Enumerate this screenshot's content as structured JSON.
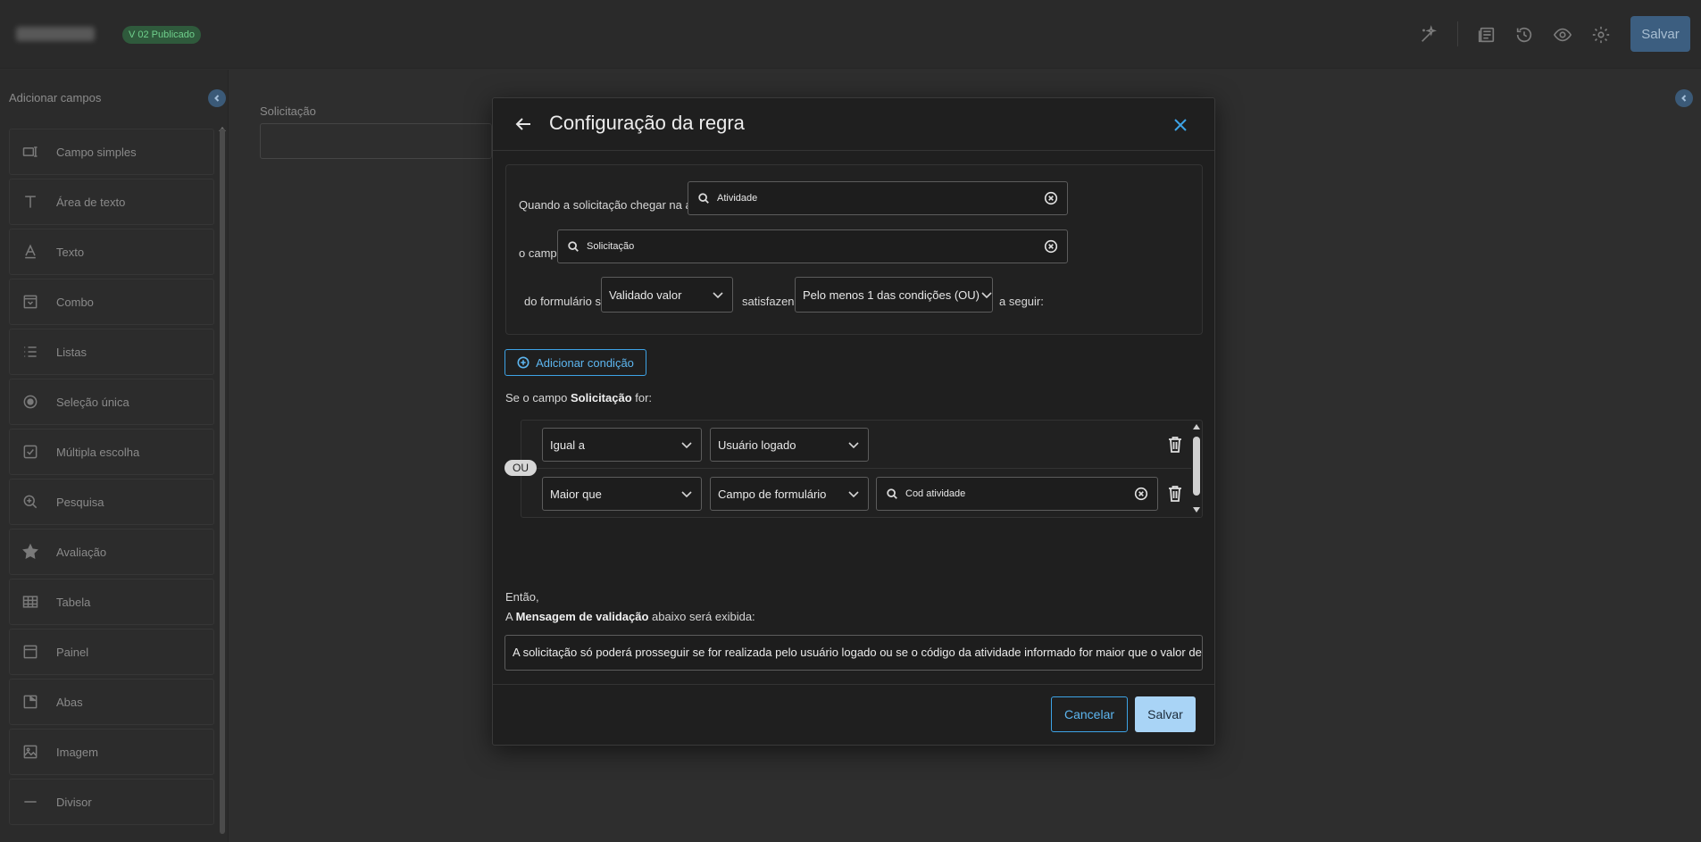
{
  "header": {
    "version_badge": "V 02 Publicado",
    "save_label": "Salvar",
    "icons": [
      "magic-wand-icon",
      "document-list-icon",
      "history-icon",
      "eye-icon",
      "gear-icon"
    ]
  },
  "sidebar": {
    "title": "Adicionar campos",
    "items": [
      {
        "label": "Campo simples",
        "icon": "input-field-icon"
      },
      {
        "label": "Área de texto",
        "icon": "text-area-icon"
      },
      {
        "label": "Texto",
        "icon": "text-icon"
      },
      {
        "label": "Combo",
        "icon": "combo-icon"
      },
      {
        "label": "Listas",
        "icon": "list-icon"
      },
      {
        "label": "Seleção única",
        "icon": "radio-icon"
      },
      {
        "label": "Múltipla escolha",
        "icon": "checkbox-icon"
      },
      {
        "label": "Pesquisa",
        "icon": "search-plus-icon"
      },
      {
        "label": "Avaliação",
        "icon": "star-icon"
      },
      {
        "label": "Tabela",
        "icon": "table-icon"
      },
      {
        "label": "Painel",
        "icon": "panel-icon"
      },
      {
        "label": "Abas",
        "icon": "tabs-icon"
      },
      {
        "label": "Imagem",
        "icon": "image-icon"
      },
      {
        "label": "Divisor",
        "icon": "divider-icon"
      }
    ]
  },
  "canvas": {
    "field_label": "Solicitação"
  },
  "modal": {
    "title": "Configuração da regra",
    "rule": {
      "activity_label": "Quando a solicitação chegar na atividade",
      "activity_value": "Atividade",
      "field_label": "o campo",
      "field_value": "Solicitação",
      "form_label": "do formulário será",
      "action_value": "Validado valor",
      "satisfying_label": "satisfazendo",
      "match_value": "Pelo menos 1 das condições (OU)",
      "suffix_label": "a seguir:"
    },
    "add_condition_label": "Adicionar condição",
    "conditions_caption": {
      "prefix": "Se o campo ",
      "field": "Solicitação",
      "suffix": " for:"
    },
    "or_badge": "OU",
    "conditions": [
      {
        "operator": "Igual a",
        "source": "Usuário logado"
      },
      {
        "operator": "Maior que",
        "source": "Campo de formulário",
        "value": "Cod atividade"
      }
    ],
    "then_text": "Então,",
    "message_caption": {
      "prefix": "A ",
      "bold": "Mensagem de validação",
      "suffix": " abaixo será exibida:"
    },
    "message_value": "A solicitação só poderá prosseguir se for realizada pelo usuário logado ou se o código da atividade informado for maior que o valor definido",
    "cancel_label": "Cancelar",
    "save_label": "Salvar"
  }
}
